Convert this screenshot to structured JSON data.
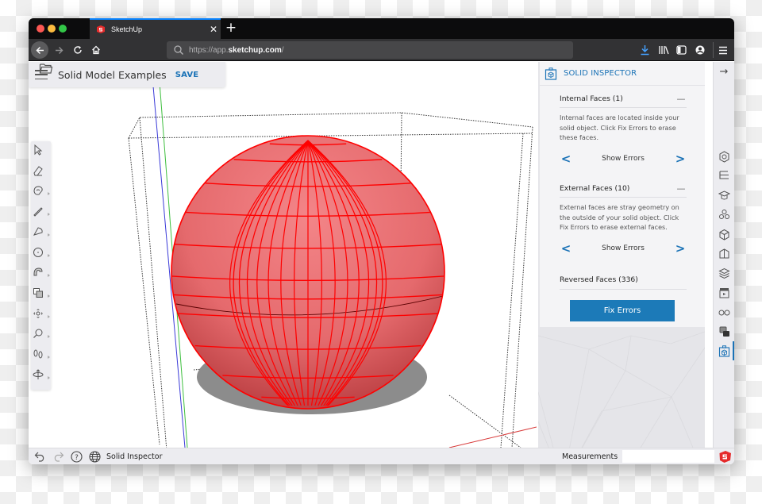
{
  "browser": {
    "window_controls": [
      "close",
      "minimize",
      "maximize"
    ],
    "tab": {
      "title": "SketchUp",
      "favicon": "sketchup-logo-icon",
      "close_glyph": "✕"
    },
    "new_tab_glyph": "+",
    "nav": {
      "back_icon": "back-arrow-icon",
      "forward_icon": "forward-arrow-icon",
      "reload_icon": "reload-icon",
      "home_icon": "home-icon"
    },
    "url": {
      "prefix": "https://app.",
      "domain": "sketchup.com",
      "suffix": "/"
    },
    "toolbar_icons": [
      "download-icon",
      "library-icon",
      "sidebar-icon",
      "account-icon",
      "menu-icon"
    ],
    "accent_color": "#0a84ff"
  },
  "app": {
    "header": {
      "title": "Solid Model Examples",
      "save_label": "SAVE"
    },
    "left_tools": [
      {
        "name": "select-tool",
        "has_flyout": false
      },
      {
        "name": "eraser-tool",
        "has_flyout": false
      },
      {
        "name": "paint-bucket-tool",
        "has_flyout": true
      },
      {
        "name": "pencil-line-tool",
        "has_flyout": true
      },
      {
        "name": "arc-tool",
        "has_flyout": true
      },
      {
        "name": "circle-tool",
        "has_flyout": true
      },
      {
        "name": "push-pull-tool",
        "has_flyout": true
      },
      {
        "name": "offset-tool",
        "has_flyout": true
      },
      {
        "name": "move-tool",
        "has_flyout": true
      },
      {
        "name": "tape-measure-tool",
        "has_flyout": true
      },
      {
        "name": "walk-tool",
        "has_flyout": true
      },
      {
        "name": "orbit-tool",
        "has_flyout": true
      }
    ],
    "inspector": {
      "title": "SOLID INSPECTOR",
      "sections": [
        {
          "heading": "Internal Faces (1)",
          "collapse_glyph": "—",
          "description": "Internal faces are located inside your solid object. Click Fix Errors to erase these faces.",
          "prev_glyph": "<",
          "show_label": "Show Errors",
          "next_glyph": ">"
        },
        {
          "heading": "External Faces (10)",
          "collapse_glyph": "—",
          "description": "External faces are stray geometry on the outside of your solid object. Click Fix Errors to erase external faces.",
          "prev_glyph": "<",
          "show_label": "Show Errors",
          "next_glyph": ">"
        },
        {
          "heading": "Reversed Faces (336)"
        }
      ],
      "fix_button": "Fix Errors",
      "brand_color": "#1c7ab8"
    },
    "rail": {
      "collapse_glyph": "→",
      "items": [
        {
          "name": "entity-info-icon",
          "active": false
        },
        {
          "name": "outliner-icon",
          "active": false
        },
        {
          "name": "instructor-icon",
          "active": false
        },
        {
          "name": "components-icon",
          "active": false
        },
        {
          "name": "materials-icon",
          "active": false
        },
        {
          "name": "styles-icon",
          "active": false
        },
        {
          "name": "tags-icon",
          "active": false
        },
        {
          "name": "scenes-icon",
          "active": false
        },
        {
          "name": "display-icon",
          "active": false
        },
        {
          "name": "extensions-icon",
          "active": false
        },
        {
          "name": "solid-inspector-icon",
          "active": true
        }
      ]
    },
    "statusbar": {
      "left_icons": [
        "undo-icon",
        "redo-icon",
        "help-icon",
        "globe-icon"
      ],
      "context_label": "Solid Inspector",
      "measurements_label": "Measurements",
      "measurements_value": ""
    },
    "scene": {
      "object": "sphere",
      "edge_color": "#ff0000",
      "face_color": "#e86b6e",
      "shadow_color": "#8c8c8c",
      "axis_colors": {
        "red": "#d83a3a",
        "green": "#3fbf3f",
        "blue": "#3a3ad8"
      }
    }
  }
}
